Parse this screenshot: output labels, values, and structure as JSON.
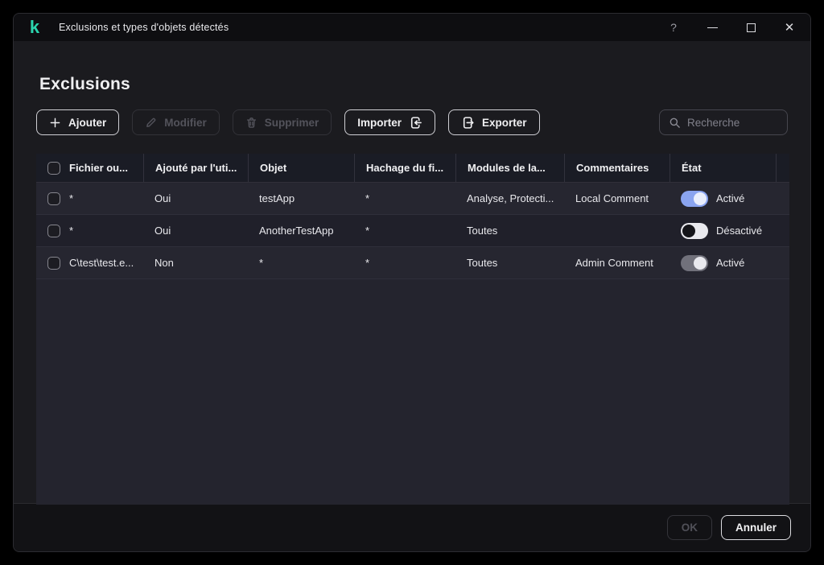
{
  "window": {
    "title": "Exclusions et types d'objets détectés",
    "logo_glyph": "k",
    "controls": {
      "help": "?",
      "close": "✕"
    }
  },
  "page": {
    "title": "Exclusions"
  },
  "toolbar": {
    "add": "Ajouter",
    "add_glyph": "+",
    "edit": "Modifier",
    "delete": "Supprimer",
    "import": "Importer",
    "export": "Exporter"
  },
  "search": {
    "placeholder": "Recherche"
  },
  "table": {
    "columns": [
      "Fichier ou...",
      "Ajouté par l'uti...",
      "Objet",
      "Hachage du fi...",
      "Modules de la...",
      "Commentaires",
      "État"
    ],
    "rows": [
      {
        "file": "*",
        "added_by_user": "Oui",
        "object": "testApp",
        "hash": "*",
        "modules": "Analyse, Protecti...",
        "comment": "Local Comment",
        "state": "Activé",
        "toggle": "on"
      },
      {
        "file": "*",
        "added_by_user": "Oui",
        "object": "AnotherTestApp",
        "hash": "*",
        "modules": "Toutes",
        "comment": "",
        "state": "Désactivé",
        "toggle": "off"
      },
      {
        "file": "C\\test\\test.e...",
        "added_by_user": "Non",
        "object": "*",
        "hash": "*",
        "modules": "Toutes",
        "comment": "Admin Comment",
        "state": "Activé",
        "toggle": "on-gray"
      }
    ]
  },
  "footer": {
    "ok": "OK",
    "cancel": "Annuler"
  },
  "colors": {
    "brand_teal": "#2bd4ae",
    "toggle_on_blue": "#8aa4f0",
    "toggle_off_track": "#e9e9ee",
    "toggle_on_gray": "#71717b",
    "window_bg": "#1b1b1f",
    "table_bg": "#24242e"
  }
}
